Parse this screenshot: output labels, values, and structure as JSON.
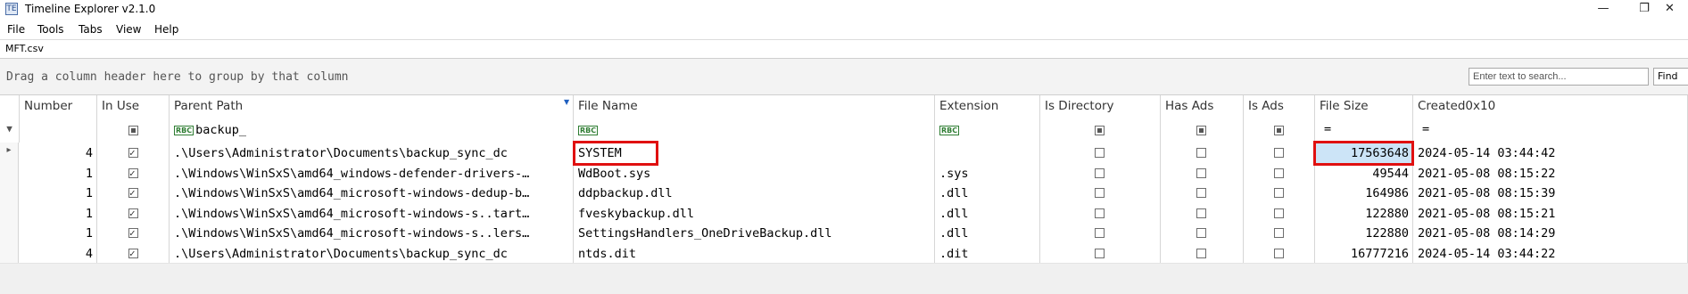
{
  "window": {
    "title": "Timeline Explorer v2.1.0",
    "minimize_glyph": "—",
    "restore_glyph": "❐",
    "close_glyph": "✕"
  },
  "menu": {
    "items": [
      "File",
      "Tools",
      "Tabs",
      "View",
      "Help"
    ]
  },
  "tabs": {
    "active": "MFT.csv"
  },
  "group_panel": {
    "hint": "Drag a column header here to group by that column"
  },
  "search": {
    "placeholder": "Enter text to search...",
    "find_label": "Find"
  },
  "grid": {
    "columns": [
      "Number",
      "In Use",
      "Parent Path",
      "File Name",
      "Extension",
      "Is Directory",
      "Has Ads",
      "Is Ads",
      "File Size",
      "Created0x10"
    ],
    "filter": {
      "parent_path": "backup_",
      "file_size_op": "=",
      "created_op": "=",
      "text_filter_icon": "RBC"
    },
    "rows": [
      {
        "number": "4",
        "in_use": true,
        "parent_path": ".\\Users\\Administrator\\Documents\\backup_sync_dc",
        "file_name": "SYSTEM",
        "extension": "",
        "is_directory": false,
        "has_ads": false,
        "is_ads": false,
        "file_size": "17563648",
        "created": "2024-05-14 03:44:42"
      },
      {
        "number": "1",
        "in_use": true,
        "parent_path": ".\\Windows\\WinSxS\\amd64_windows-defender-drivers-…",
        "file_name": "WdBoot.sys",
        "extension": ".sys",
        "is_directory": false,
        "has_ads": false,
        "is_ads": false,
        "file_size": "49544",
        "created": "2021-05-08 08:15:22"
      },
      {
        "number": "1",
        "in_use": true,
        "parent_path": ".\\Windows\\WinSxS\\amd64_microsoft-windows-dedup-b…",
        "file_name": "ddpbackup.dll",
        "extension": ".dll",
        "is_directory": false,
        "has_ads": false,
        "is_ads": false,
        "file_size": "164986",
        "created": "2021-05-08 08:15:39"
      },
      {
        "number": "1",
        "in_use": true,
        "parent_path": ".\\Windows\\WinSxS\\amd64_microsoft-windows-s..tart…",
        "file_name": "fveskybackup.dll",
        "extension": ".dll",
        "is_directory": false,
        "has_ads": false,
        "is_ads": false,
        "file_size": "122880",
        "created": "2021-05-08 08:15:21"
      },
      {
        "number": "1",
        "in_use": true,
        "parent_path": ".\\Windows\\WinSxS\\amd64_microsoft-windows-s..lers…",
        "file_name": "SettingsHandlers_OneDriveBackup.dll",
        "extension": ".dll",
        "is_directory": false,
        "has_ads": false,
        "is_ads": false,
        "file_size": "122880",
        "created": "2021-05-08 08:14:29"
      },
      {
        "number": "4",
        "in_use": true,
        "parent_path": ".\\Users\\Administrator\\Documents\\backup_sync_dc",
        "file_name": "ntds.dit",
        "extension": ".dit",
        "is_directory": false,
        "has_ads": false,
        "is_ads": false,
        "file_size": "16777216",
        "created": "2024-05-14 03:44:22"
      }
    ]
  },
  "colors": {
    "highlight_box": "#e01010",
    "selected_cell": "#cce4f7"
  }
}
